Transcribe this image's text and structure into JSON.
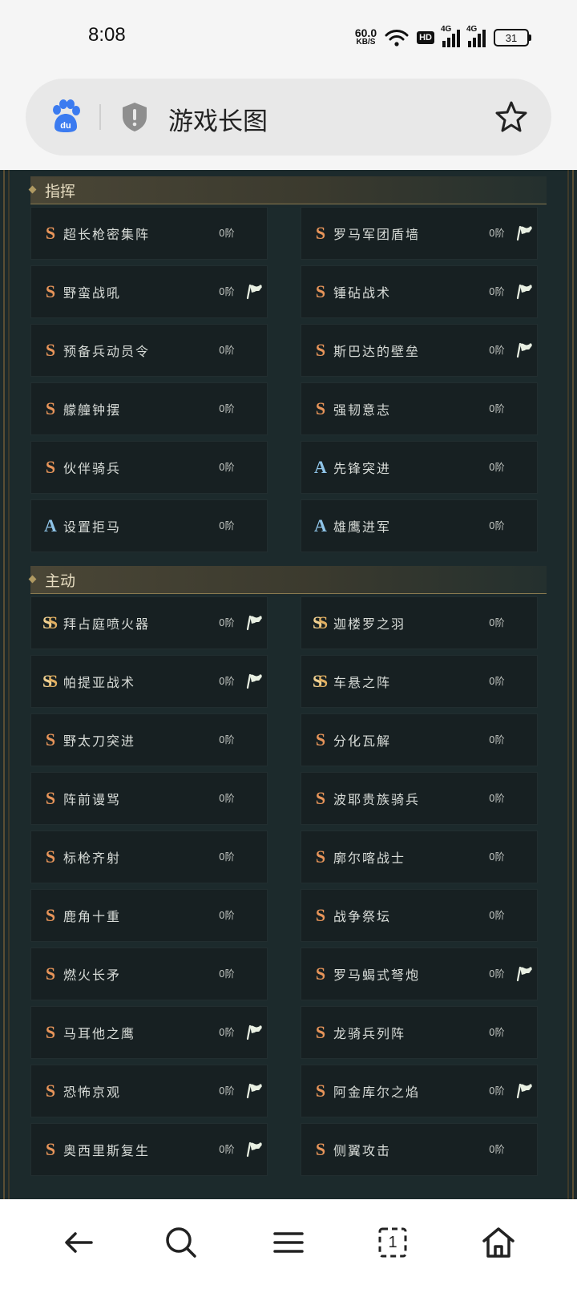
{
  "status_bar": {
    "time": "8:08",
    "net_speed_value": "60.0",
    "net_speed_unit": "KB/S",
    "hd_label": "HD",
    "signal_1_label": "4G",
    "signal_2_label": "4G",
    "battery_level": "31"
  },
  "address_bar": {
    "title": "游戏长图",
    "left_icon": "baidu-paw-icon",
    "security_icon": "shield-icon",
    "bookmark_icon": "star-icon"
  },
  "sections": [
    {
      "title": "指挥",
      "items": [
        {
          "grade": "S",
          "name": "超长枪密集阵",
          "level": "0阶",
          "flag": false
        },
        {
          "grade": "S",
          "name": "罗马军团盾墙",
          "level": "0阶",
          "flag": true
        },
        {
          "grade": "S",
          "name": "野蛮战吼",
          "level": "0阶",
          "flag": true
        },
        {
          "grade": "S",
          "name": "锤砧战术",
          "level": "0阶",
          "flag": true
        },
        {
          "grade": "S",
          "name": "预备兵动员令",
          "level": "0阶",
          "flag": false
        },
        {
          "grade": "S",
          "name": "斯巴达的壁垒",
          "level": "0阶",
          "flag": true
        },
        {
          "grade": "S",
          "name": "艨艟钟摆",
          "level": "0阶",
          "flag": false
        },
        {
          "grade": "S",
          "name": "强韧意志",
          "level": "0阶",
          "flag": false
        },
        {
          "grade": "S",
          "name": "伙伴骑兵",
          "level": "0阶",
          "flag": false
        },
        {
          "grade": "A",
          "name": "先锋突进",
          "level": "0阶",
          "flag": false
        },
        {
          "grade": "A",
          "name": "设置拒马",
          "level": "0阶",
          "flag": false
        },
        {
          "grade": "A",
          "name": "雄鹰进军",
          "level": "0阶",
          "flag": false
        }
      ]
    },
    {
      "title": "主动",
      "items": [
        {
          "grade": "SS",
          "name": "拜占庭喷火器",
          "level": "0阶",
          "flag": true
        },
        {
          "grade": "SS",
          "name": "迦楼罗之羽",
          "level": "0阶",
          "flag": false
        },
        {
          "grade": "SS",
          "name": "帕提亚战术",
          "level": "0阶",
          "flag": true
        },
        {
          "grade": "SS",
          "name": "车悬之阵",
          "level": "0阶",
          "flag": false
        },
        {
          "grade": "S",
          "name": "野太刀突进",
          "level": "0阶",
          "flag": false
        },
        {
          "grade": "S",
          "name": "分化瓦解",
          "level": "0阶",
          "flag": false
        },
        {
          "grade": "S",
          "name": "阵前谩骂",
          "level": "0阶",
          "flag": false
        },
        {
          "grade": "S",
          "name": "波耶贵族骑兵",
          "level": "0阶",
          "flag": false
        },
        {
          "grade": "S",
          "name": "标枪齐射",
          "level": "0阶",
          "flag": false
        },
        {
          "grade": "S",
          "name": "廓尔喀战士",
          "level": "0阶",
          "flag": false
        },
        {
          "grade": "S",
          "name": "鹿角十重",
          "level": "0阶",
          "flag": false
        },
        {
          "grade": "S",
          "name": "战争祭坛",
          "level": "0阶",
          "flag": false
        },
        {
          "grade": "S",
          "name": "燃火长矛",
          "level": "0阶",
          "flag": false
        },
        {
          "grade": "S",
          "name": "罗马蝎式弩炮",
          "level": "0阶",
          "flag": true
        },
        {
          "grade": "S",
          "name": "马耳他之鹰",
          "level": "0阶",
          "flag": true
        },
        {
          "grade": "S",
          "name": "龙骑兵列阵",
          "level": "0阶",
          "flag": false
        },
        {
          "grade": "S",
          "name": "恐怖京观",
          "level": "0阶",
          "flag": true
        },
        {
          "grade": "S",
          "name": "阿金库尔之焰",
          "level": "0阶",
          "flag": true
        },
        {
          "grade": "S",
          "name": "奥西里斯复生",
          "level": "0阶",
          "flag": true
        },
        {
          "grade": "S",
          "name": "侧翼攻击",
          "level": "0阶",
          "flag": false
        }
      ]
    }
  ],
  "bottom_nav": {
    "items": [
      "back-arrow-icon",
      "search-icon",
      "menu-icon",
      "tabs-icon",
      "home-icon"
    ],
    "tabs_count": "1"
  },
  "colors": {
    "content_bg": "#1c2a2c",
    "card_bg": "#172022",
    "grade_s": "#e8955a",
    "grade_ss": "#e2b062",
    "grade_a": "#8fc4e8",
    "header_text": "#e6dcc0"
  }
}
